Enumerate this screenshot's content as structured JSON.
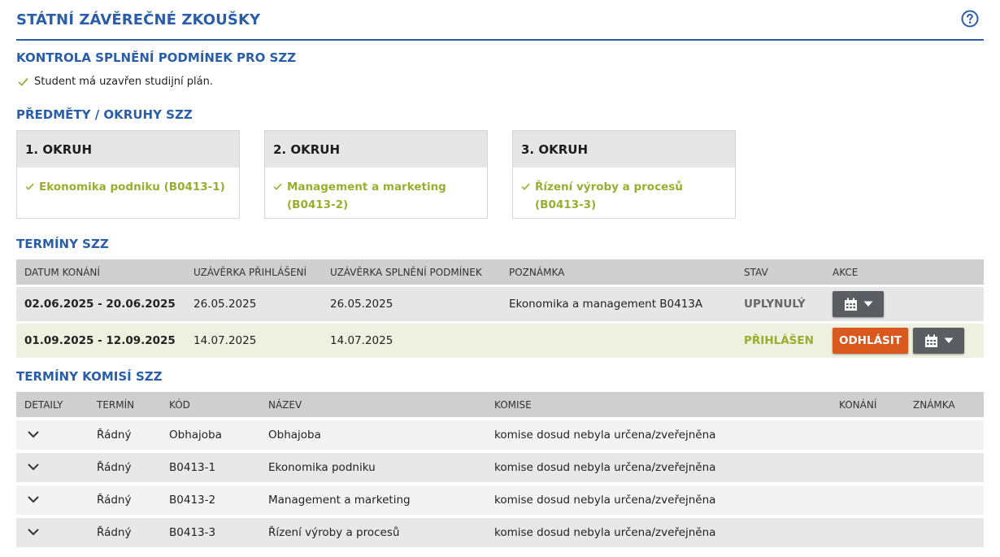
{
  "header": {
    "title": "STÁTNÍ ZÁVĚREČNÉ ZKOUŠKY",
    "help_icon": "question-circle-icon"
  },
  "conditions": {
    "title": "KONTROLA SPLNĚNÍ PODMÍNEK PRO SZZ",
    "items": [
      "Student má uzavřen studijní plán."
    ]
  },
  "subjects": {
    "title": "PŘEDMĚTY / OKRUHY SZZ",
    "okruhy": [
      {
        "header": "1. OKRUH",
        "item": "Ekonomika podniku (B0413-1)"
      },
      {
        "header": "2. OKRUH",
        "item": "Management a marketing (B0413-2)"
      },
      {
        "header": "3. OKRUH",
        "item": "Řízení výroby a procesů (B0413-3)"
      }
    ]
  },
  "terms": {
    "title": "TERMÍNY SZZ",
    "columns": [
      "DATUM KONÁNÍ",
      "UZÁVĚRKA PŘIHLÁŠENÍ",
      "UZÁVĚRKA SPLNĚNÍ PODMÍNEK",
      "POZNÁMKA",
      "STAV",
      "AKCE"
    ],
    "rows": [
      {
        "datum": "02.06.2025 - 20.06.2025",
        "uzaverka_prihlaseni": "26.05.2025",
        "uzaverka_podminek": "26.05.2025",
        "poznamka": "Ekonomika a management B0413A",
        "stav": "UPLYNULÝ"
      },
      {
        "datum": "01.09.2025 - 12.09.2025",
        "uzaverka_prihlaseni": "14.07.2025",
        "uzaverka_podminek": "14.07.2025",
        "poznamka": "",
        "stav": "PŘIHLÁŠEN",
        "action_label": "ODHLÁSIT"
      }
    ]
  },
  "komise": {
    "title": "TERMÍNY KOMISÍ SZZ",
    "columns": [
      "DETAILY",
      "TERMÍN",
      "KÓD",
      "NÁZEV",
      "KOMISE",
      "KONÁNÍ",
      "ZNÁMKA"
    ],
    "rows": [
      {
        "termin": "Řádný",
        "kod": "Obhajoba",
        "nazev": "Obhajoba",
        "komise": "komise dosud nebyla určena/zveřejněna",
        "konani": "",
        "znamka": ""
      },
      {
        "termin": "Řádný",
        "kod": "B0413-1",
        "nazev": "Ekonomika podniku",
        "komise": "komise dosud nebyla určena/zveřejněna",
        "konani": "",
        "znamka": ""
      },
      {
        "termin": "Řádný",
        "kod": "B0413-2",
        "nazev": "Management a marketing",
        "komise": "komise dosud nebyla určena/zveřejněna",
        "konani": "",
        "znamka": ""
      },
      {
        "termin": "Řádný",
        "kod": "B0413-3",
        "nazev": "Řízení výroby a procesů",
        "komise": "komise dosud nebyla určena/zveřejněna",
        "konani": "",
        "znamka": ""
      }
    ]
  },
  "colors": {
    "accent_blue": "#2a5ea8",
    "success_green": "#9aad2e",
    "danger_orange": "#d9581d",
    "button_grey": "#5a5e63"
  }
}
